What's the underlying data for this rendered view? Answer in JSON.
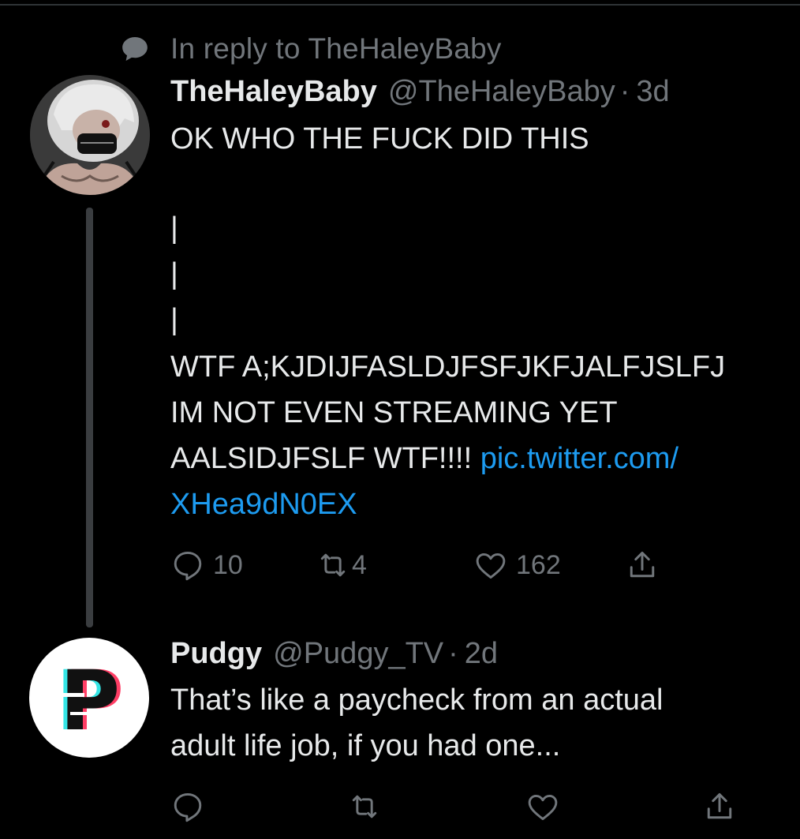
{
  "reply_context": {
    "text": "In reply to TheHaleyBaby"
  },
  "tweet1": {
    "name": "TheHaleyBaby",
    "handle": "@TheHaleyBaby",
    "separator": "·",
    "time": "3d",
    "lines": [
      "OK WHO THE FUCK DID THIS",
      "|",
      "|",
      "|",
      "WTF A;KJDIJFASLDJFSFJKFJALFJSLFJ",
      "IM NOT EVEN STREAMING YET"
    ],
    "last_line_text": "AALSIDJFSLF WTF!!!! ",
    "link_part1": "pic.twitter.com/",
    "link_part2": "XHea9dN0EX",
    "replies": "10",
    "retweets": "4",
    "likes": "162"
  },
  "tweet2": {
    "name": "Pudgy",
    "handle": "@Pudgy_TV",
    "separator": "·",
    "time": "2d",
    "lines": [
      "That’s like a paycheck from an actual",
      "adult life job, if you had one..."
    ],
    "avatar_letter": "P"
  },
  "colors": {
    "background": "#000000",
    "text": "#e7e9ea",
    "muted": "#71767b",
    "link": "#1d9bf0"
  }
}
